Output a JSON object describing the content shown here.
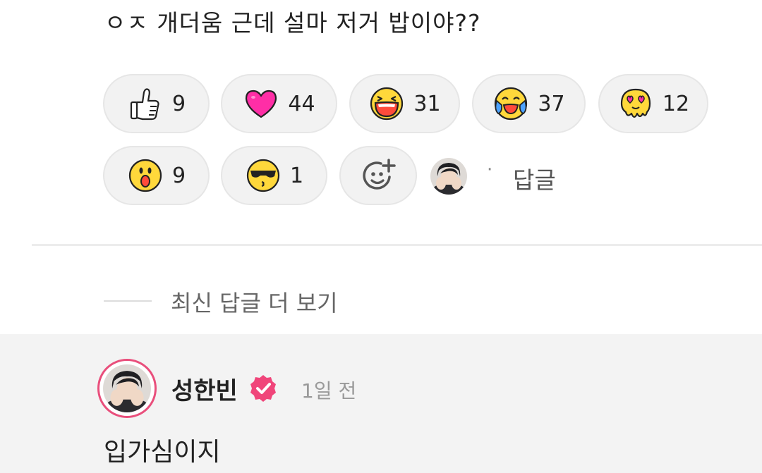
{
  "comment": {
    "text": "ㅇㅈ 개더움 근데 설마 저거 밥이야??"
  },
  "reactions": [
    {
      "emoji": "thumbs-up",
      "count": "9"
    },
    {
      "emoji": "pink-heart",
      "count": "44"
    },
    {
      "emoji": "laughing-face",
      "count": "31"
    },
    {
      "emoji": "crying-laughing-face",
      "count": "37"
    },
    {
      "emoji": "melting-heart-eyes-face",
      "count": "12"
    },
    {
      "emoji": "surprised-face",
      "count": "9"
    },
    {
      "emoji": "cool-sunglasses-face",
      "count": "1"
    }
  ],
  "add_reaction": {
    "icon": "add-emoji-icon"
  },
  "reply_action": {
    "separator": "·",
    "label": "답글"
  },
  "more_replies": {
    "label": "최신 답글 더 보기"
  },
  "reply": {
    "author": "성한빈",
    "verified": true,
    "time": "1일 전",
    "text": "입가심이지"
  },
  "colors": {
    "accent_pink": "#e94f7c",
    "pill_bg": "#f2f2f2",
    "emoji_yellow": "#ffd83b"
  }
}
